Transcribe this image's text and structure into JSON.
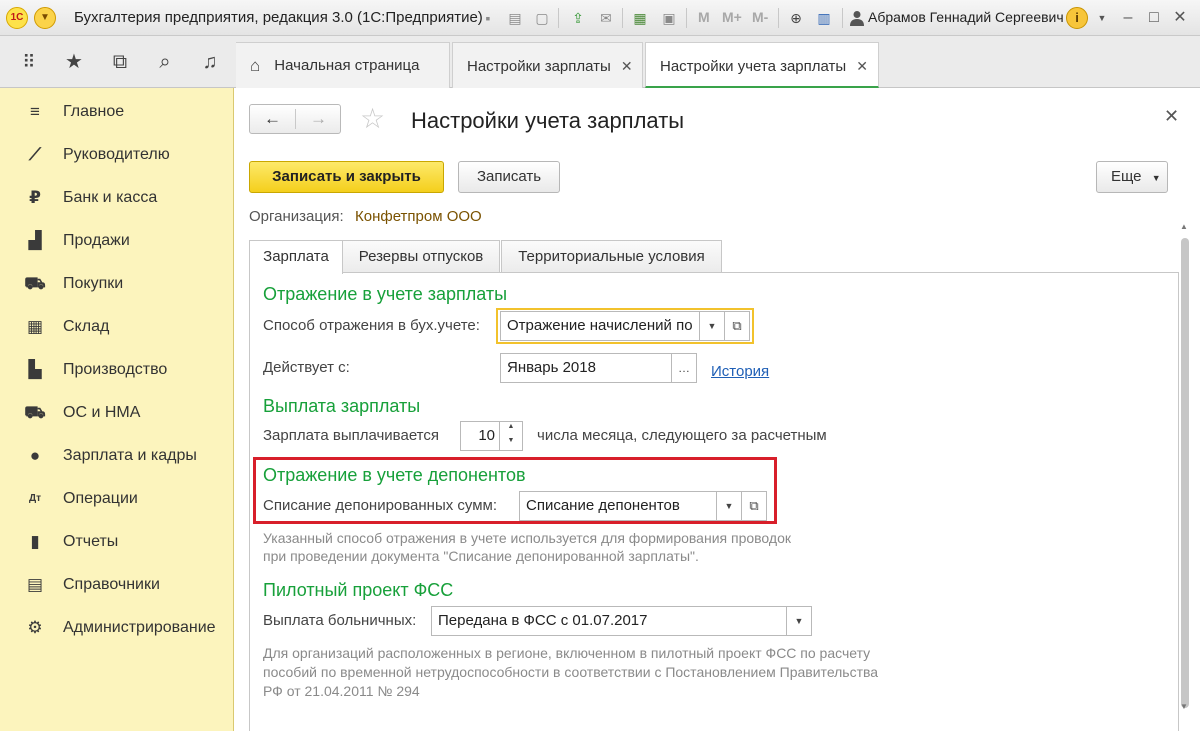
{
  "window": {
    "title": "Бухгалтерия предприятия, редакция 3.0  (1С:Предприятие)",
    "logo_text": "1С",
    "menu_icon": "chevron-down-icon",
    "toolbar_m_labels": [
      "M",
      "M+",
      "M-"
    ],
    "user_name": "Абрамов Геннадий Сергеевич"
  },
  "tabs": [
    {
      "label": "Начальная страница",
      "closable": false
    },
    {
      "label": "Настройки зарплаты",
      "closable": true
    },
    {
      "label": "Настройки учета зарплаты",
      "closable": true,
      "active": true
    }
  ],
  "sidebar": {
    "items": [
      {
        "label": "Главное",
        "icon": "menu-lines-icon"
      },
      {
        "label": "Руководителю",
        "icon": "trend-icon"
      },
      {
        "label": "Банк и касса",
        "icon": "ruble-coin-icon"
      },
      {
        "label": "Продажи",
        "icon": "shopping-bag-icon"
      },
      {
        "label": "Покупки",
        "icon": "cart-icon"
      },
      {
        "label": "Склад",
        "icon": "warehouse-icon"
      },
      {
        "label": "Производство",
        "icon": "factory-icon"
      },
      {
        "label": "ОС и НМА",
        "icon": "truck-icon"
      },
      {
        "label": "Зарплата и кадры",
        "icon": "person-icon"
      },
      {
        "label": "Операции",
        "icon": "dt-kt-icon"
      },
      {
        "label": "Отчеты",
        "icon": "bar-chart-icon"
      },
      {
        "label": "Справочники",
        "icon": "books-icon"
      },
      {
        "label": "Администрирование",
        "icon": "gear-icon"
      }
    ]
  },
  "form": {
    "title": "Настройки учета зарплаты",
    "buttons": {
      "save_close": "Записать и закрыть",
      "save": "Записать",
      "more": "Еще"
    },
    "organization_label": "Организация:",
    "organization_value": "Конфетпром ООО",
    "tabs": [
      "Зарплата",
      "Резервы отпусков",
      "Территориальные условия"
    ],
    "sections": {
      "accounting": {
        "heading": "Отражение в учете зарплаты",
        "method_label": "Способ отражения в бух.учете:",
        "method_value": "Отражение начислений по",
        "valid_from_label": "Действует с:",
        "valid_from_value": "Январь 2018",
        "history_link": "История"
      },
      "payment": {
        "heading": "Выплата зарплаты",
        "pay_label": "Зарплата выплачивается",
        "pay_day": "10",
        "pay_suffix": "числа месяца, следующего за расчетным"
      },
      "deposits": {
        "heading": "Отражение в учете депонентов",
        "writeoff_label": "Списание депонированных сумм:",
        "writeoff_value": "Списание депонентов",
        "note_line1": "Указанный способ отражения в учете используется для формирования проводок",
        "note_line2": "при проведении документа \"Списание депонированной зарплаты\"."
      },
      "fss": {
        "heading": "Пилотный проект ФСС",
        "sick_label": "Выплата больничных:",
        "sick_value": "Передана в ФСС с 01.07.2017",
        "note_line1": "Для организаций расположенных в регионе, включенном в пилотный проект ФСС по расчету",
        "note_line2": "пособий по временной нетрудоспособности в соответствии с Постановлением Правительства",
        "note_line3": "РФ от 21.04.2011 № 294"
      }
    }
  },
  "colors": {
    "sidebar_bg": "#fcf4bd",
    "primary_button": "#f4cf1c",
    "section_heading": "#17a03a",
    "highlight_yellow": "#f2c22c",
    "highlight_red": "#d81f2a",
    "link": "#1f5fb6"
  }
}
